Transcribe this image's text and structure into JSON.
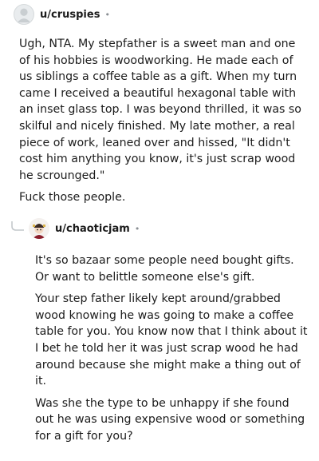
{
  "comments": [
    {
      "username": "u/cruspies",
      "separator": "•",
      "paragraphs": [
        "Ugh, NTA. My stepfather is a sweet man and one of his hobbies is woodworking. He made each of us siblings a coffee table as a gift. When my turn came I received a beautiful hexagonal table with an inset glass top. I was beyond thrilled, it was so skilful and nicely finished. My late mother, a real piece of work, leaned over and hissed, \"It didn't cost him anything you know, it's just scrap wood he scrounged.\"",
        "Fuck those people."
      ]
    },
    {
      "username": "u/chaoticjam",
      "separator": "•",
      "paragraphs": [
        "It's so bazaar some people need bought gifts. Or want to belittle someone else's gift.",
        "Your step father likely kept around/grabbed wood knowing he was going to make a coffee table for you. You know now that I think about it I bet he told her it was just scrap wood he had around because she might make a thing out of it.",
        "Was she the type to be unhappy if she found out he was using expensive wood or something for a gift for you?"
      ]
    }
  ],
  "icons": {
    "avatar_1": "default-avatar-icon",
    "avatar_2": "character-avatar-icon",
    "reply_connector": "reply-curve-icon"
  }
}
